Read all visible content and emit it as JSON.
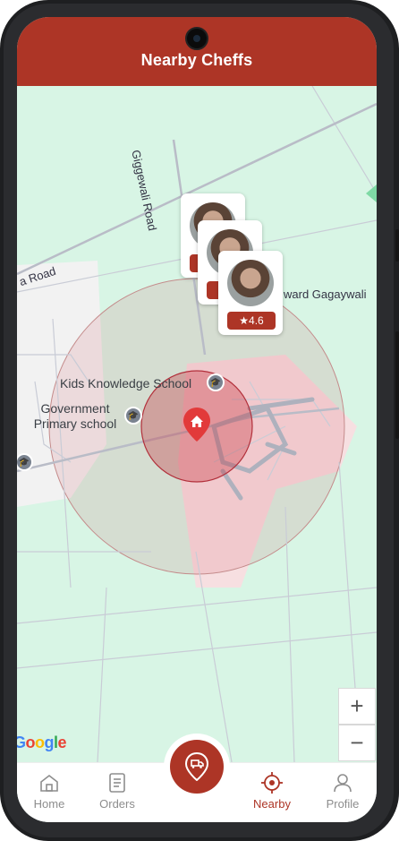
{
  "header": {
    "title": "Nearby Cheffs"
  },
  "map": {
    "roads": [
      "Giggewali Road",
      "a Road",
      "ward Gagaywali"
    ],
    "pois": [
      {
        "name": "Kids Knowledge School",
        "icon": "school-icon"
      },
      {
        "name": "Government\nPrimary school",
        "icon": "school-icon"
      }
    ],
    "home_marker_icon": "home-pin-icon",
    "attribution": "Google",
    "zoom_in": "+",
    "zoom_out": "−"
  },
  "chefs": [
    {
      "rating": ""
    },
    {
      "rating": ""
    },
    {
      "rating": "★4.6"
    }
  ],
  "nav": {
    "home": "Home",
    "orders": "Orders",
    "nearby": "Nearby",
    "profile": "Profile",
    "active": "Nearby",
    "fab_icon": "delivery-pin-icon"
  },
  "colors": {
    "brand": "#ad3526",
    "map": "#d7f5e4"
  }
}
